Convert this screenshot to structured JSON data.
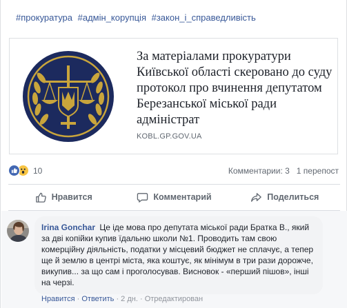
{
  "post": {
    "hashtags": [
      "#прокуратура",
      "#адмін_корупція",
      "#закон_і_справедливість"
    ],
    "link": {
      "title": "За матеріалами прокуратури Київської області скеровано до суду протокол про вчинення депутатом Березанської міської ради адміністрат",
      "domain": "KOBL.GP.GOV.UA"
    },
    "stats": {
      "reaction_count": "10",
      "comments": "Комментарии: 3",
      "shares": "1 перепост"
    },
    "actions": {
      "like": "Нравится",
      "comment": "Комментарий",
      "share": "Поделиться"
    }
  },
  "comment": {
    "author": "Irina Gonchar",
    "text": "Це іде мова про депутата міської ради Братка В., який за дві копійки купив їдальню школи №1. Проводить там свою комерційну діяльність, податки у місцевий бюджет не сплачує, а тепер ще й землю в центрі міста, яка коштує, як мінімум в три рази дорожче, викупив... за що сам і проголосував. Висновок - «перший пішов», інші на черзі.",
    "like_label": "Нравится",
    "reply_label": "Ответить",
    "time": "2 дн.",
    "edited": "Отредактирован",
    "separator": "·"
  },
  "icons": {
    "like_reaction": "thumbs-up-icon",
    "wow_reaction": "wow-face-icon",
    "like_action": "thumbs-up-outline-icon",
    "comment_action": "speech-bubble-icon",
    "share_action": "share-arrow-icon",
    "link_thumbnail": "prosecutor-emblem-icon"
  },
  "colors": {
    "link_blue": "#385898",
    "meta_gray": "#606770",
    "emblem_navy": "#1c2a5e",
    "emblem_gold": "#c9a53c"
  }
}
